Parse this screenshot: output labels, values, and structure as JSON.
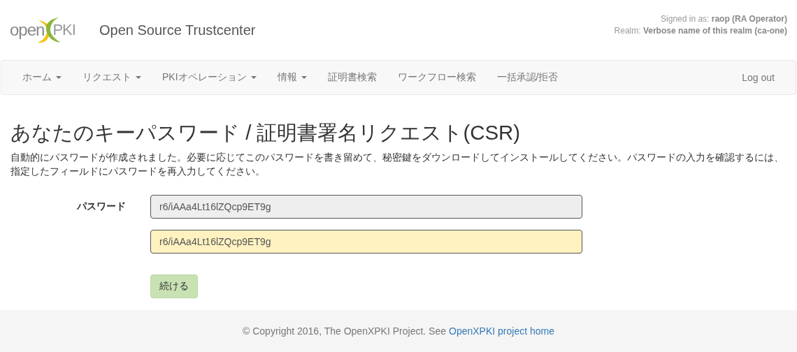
{
  "header": {
    "logo": {
      "left": "open",
      "right": "PKI"
    },
    "title": "Open Source Trustcenter",
    "user_lines": [
      "Signed in as: **raop (RA Operator)**",
      "Realm: **Verbose name of this realm (ca-one)**"
    ]
  },
  "nav": {
    "items": [
      {
        "label": "ホーム",
        "dropdown": true
      },
      {
        "label": "リクエスト",
        "dropdown": true
      },
      {
        "label": "PKIオペレーション",
        "dropdown": true
      },
      {
        "label": "情報",
        "dropdown": true
      },
      {
        "label": "証明書検索",
        "dropdown": false
      },
      {
        "label": "ワークフロー検索",
        "dropdown": false
      },
      {
        "label": "一括承認/拒否",
        "dropdown": false
      }
    ],
    "logout": "Log out"
  },
  "page": {
    "heading": "あなたのキーパスワード / 証明書署名リクエスト(CSR)",
    "description": "自動的にパスワードが作成されました。必要に応じてこのパスワードを書き留めて、秘密鍵をダウンロードしてインストールしてください。パスワードの入力を確認するには、指定したフィールドにパスワードを再入力してください。",
    "label": "パスワード",
    "fields": [
      {
        "value": "r6/iAAa4Lt16lZQcp9ET9g",
        "readonly": true
      },
      {
        "value": "r6/iAAa4Lt16lZQcp9ET9g",
        "readonly": false
      }
    ],
    "button": "続ける"
  },
  "footer": {
    "text": "© Copyright 2016, The OpenXPKI Project. See",
    "link": "OpenXPKI project home"
  }
}
